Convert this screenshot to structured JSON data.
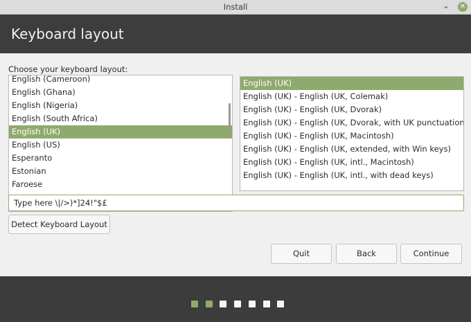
{
  "window": {
    "title": "Install"
  },
  "header": {
    "title": "Keyboard layout"
  },
  "main": {
    "prompt": "Choose your keyboard layout:",
    "layouts": [
      {
        "label": "English (Cameroon)",
        "selected": false
      },
      {
        "label": "English (Ghana)",
        "selected": false
      },
      {
        "label": "English (Nigeria)",
        "selected": false
      },
      {
        "label": "English (South Africa)",
        "selected": false
      },
      {
        "label": "English (UK)",
        "selected": true
      },
      {
        "label": "English (US)",
        "selected": false
      },
      {
        "label": "Esperanto",
        "selected": false
      },
      {
        "label": "Estonian",
        "selected": false
      },
      {
        "label": "Faroese",
        "selected": false
      }
    ],
    "variants": [
      {
        "label": "English (UK)",
        "selected": true
      },
      {
        "label": "English (UK) - English (UK, Colemak)",
        "selected": false
      },
      {
        "label": "English (UK) - English (UK, Dvorak)",
        "selected": false
      },
      {
        "label": "English (UK) - English (UK, Dvorak, with UK punctuation)",
        "selected": false
      },
      {
        "label": "English (UK) - English (UK, Macintosh)",
        "selected": false
      },
      {
        "label": "English (UK) - English (UK, extended, with Win keys)",
        "selected": false
      },
      {
        "label": "English (UK) - English (UK, intl., Macintosh)",
        "selected": false
      },
      {
        "label": "English (UK) - English (UK, intl., with dead keys)",
        "selected": false
      }
    ],
    "test_field_value": "Type here \\|/>)*]24!\"$£",
    "detect_label": "Detect Keyboard Layout"
  },
  "buttons": {
    "quit": "Quit",
    "back": "Back",
    "continue": "Continue"
  },
  "progress": {
    "total_steps": 7,
    "completed_steps": 2
  },
  "colors": {
    "accent": "#8faa6d",
    "header_bg": "#3d3d3d",
    "content_bg": "#f0f0f0"
  }
}
